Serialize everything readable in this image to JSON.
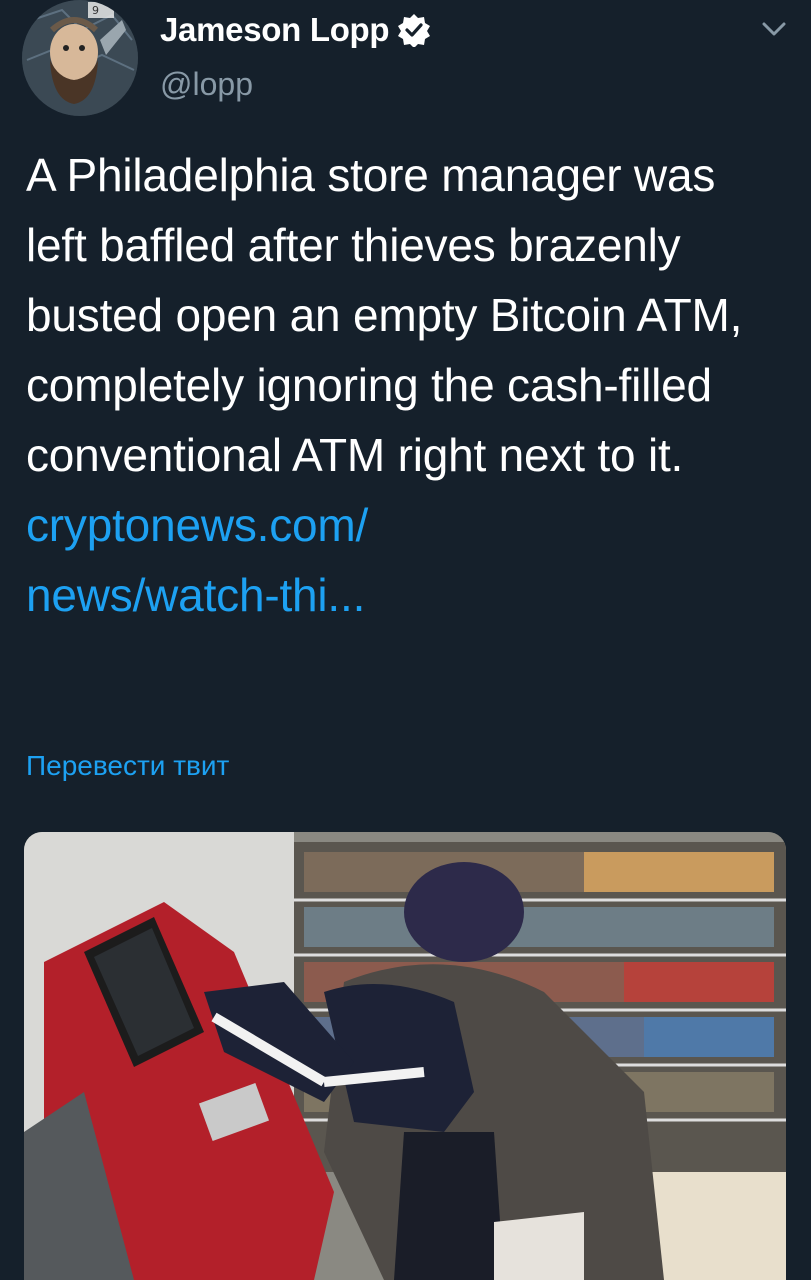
{
  "tweet": {
    "display_name": "Jameson Lopp",
    "handle": "@lopp",
    "text_before_link": "A Philadelphia store manager was left baffled after thieves brazenly busted open an empty Bitcoin ATM, completely ignoring the cash-filled conventional ATM right next to it. ",
    "link_text": "cryptonews.com/\nnews/watch-thi...",
    "translate_label": "Перевести твит",
    "verified": true,
    "media_description_icon": "photo-image"
  },
  "colors": {
    "background": "#15202b",
    "text_primary": "#ffffff",
    "text_secondary": "#8899a6",
    "accent": "#1da1f2"
  },
  "icons": {
    "verified": "verified-badge-icon",
    "caret": "chevron-down-icon"
  }
}
